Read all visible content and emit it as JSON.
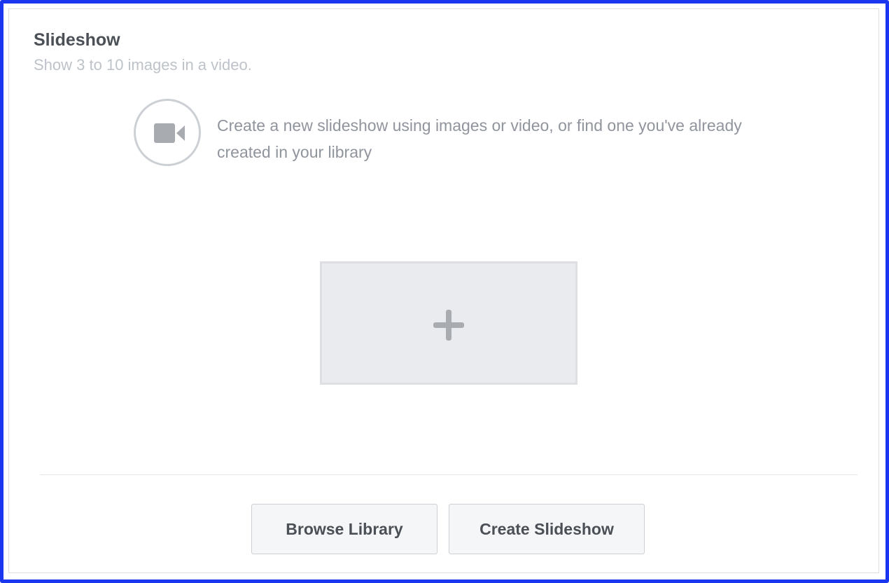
{
  "header": {
    "title": "Slideshow",
    "subtitle": "Show 3 to 10 images in a video."
  },
  "info": {
    "icon": "video-camera-icon",
    "text": "Create a new slideshow using images or video, or find one you've already created in your library"
  },
  "add_tile": {
    "icon": "plus-icon"
  },
  "footer": {
    "browse_label": "Browse Library",
    "create_label": "Create Slideshow"
  },
  "colors": {
    "frame_border": "#1a36f0",
    "title": "#4b4f56",
    "subtitle": "#bec3c9",
    "text": "#90949c",
    "tile_bg": "#e9ebee",
    "icon": "#a8abb0"
  }
}
